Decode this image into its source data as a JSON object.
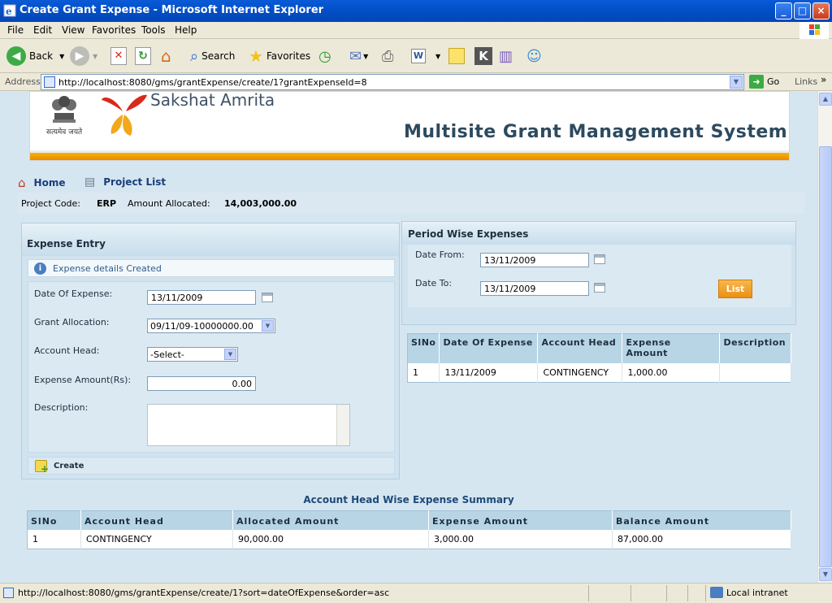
{
  "window": {
    "title": "Create Grant Expense - Microsoft Internet Explorer",
    "controls": {
      "minimize": "_",
      "maximize": "□",
      "close": "×"
    }
  },
  "menu": [
    "File",
    "Edit",
    "View",
    "Favorites",
    "Tools",
    "Help"
  ],
  "toolbar": {
    "back": "Back",
    "search": "Search",
    "favorites": "Favorites"
  },
  "address": {
    "label": "Address",
    "url": "http://localhost:8080/gms/grantExpense/create/1?grantExpenseId=8",
    "go": "Go",
    "links": "Links",
    "more": "»"
  },
  "banner": {
    "brand": "Sakshat Amrita",
    "motto": "सत्यमेव जयते",
    "system_title": "Multisite Grant Management System"
  },
  "nav": {
    "home": "Home",
    "project_list": "Project List"
  },
  "project": {
    "code_label": "Project Code:",
    "code": "ERP",
    "amount_label": "Amount Allocated:",
    "amount": "14,003,000.00"
  },
  "entry": {
    "title": "Expense Entry",
    "message": "Expense details Created",
    "fields": {
      "date_label": "Date Of Expense:",
      "date_value": "13/11/2009",
      "grant_label": "Grant Allocation:",
      "grant_value": "09/11/09-10000000.00",
      "account_label": "Account Head:",
      "account_value": "-Select-",
      "amount_label": "Expense Amount(Rs):",
      "amount_value": "0.00",
      "desc_label": "Description:"
    },
    "create": "Create"
  },
  "period": {
    "title": "Period Wise Expenses",
    "from_label": "Date From:",
    "from_value": "13/11/2009",
    "to_label": "Date To:",
    "to_value": "13/11/2009",
    "list": "List"
  },
  "period_table": {
    "headers": [
      "SlNo",
      "Date Of Expense",
      "Account Head",
      "Expense Amount",
      "Description"
    ],
    "rows": [
      [
        "1",
        "13/11/2009",
        "CONTINGENCY",
        "1,000.00",
        ""
      ]
    ]
  },
  "summary": {
    "title": "Account Head Wise Expense Summary",
    "headers": [
      "SlNo",
      "Account Head",
      "Allocated Amount",
      "Expense Amount",
      "Balance Amount"
    ],
    "rows": [
      [
        "1",
        "CONTINGENCY",
        "90,000.00",
        "3,000.00",
        "87,000.00"
      ]
    ]
  },
  "status": {
    "url": "http://localhost:8080/gms/grantExpense/create/1?sort=dateOfExpense&order=asc",
    "zone": "Local intranet"
  },
  "colors": {
    "accent_orange": "#ec8f12",
    "title_blue": "#2d4a5e",
    "panel": "#d0e3ef"
  }
}
